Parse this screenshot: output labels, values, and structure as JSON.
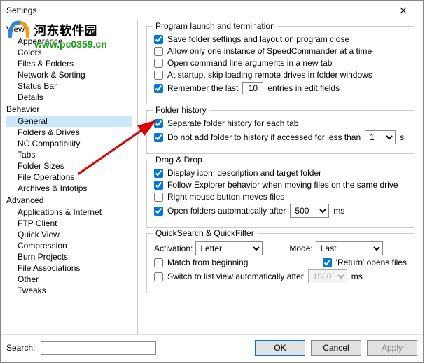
{
  "window": {
    "title": "Settings"
  },
  "watermark": {
    "site_cn": "河东软件园",
    "url": "www.pc0359.cn",
    "view": "View"
  },
  "tree": {
    "cat_view": "View",
    "cat_behavior": "Behavior",
    "cat_advanced": "Advanced",
    "view_items": [
      "Appearance",
      "Colors",
      "Files & Folders",
      "Network & Sorting",
      "Status Bar",
      "Details"
    ],
    "behavior_items": [
      "General",
      "Folders & Drives",
      "NC Compatibility",
      "Tabs",
      "Folder Sizes",
      "File Operations",
      "Archives & Infotips"
    ],
    "advanced_items": [
      "Applications & Internet",
      "FTP Client",
      "Quick View",
      "Compression",
      "Burn Projects",
      "File Associations",
      "Other",
      "Tweaks"
    ],
    "selected": "General"
  },
  "groups": {
    "launch": {
      "legend": "Program launch and termination",
      "save_folder": "Save folder settings and layout on program close",
      "only_one": "Allow only one instance of SpeedCommander at a time",
      "cmd_args": "Open command line arguments in a new tab",
      "skip_remote": "At startup, skip loading remote drives in folder windows",
      "remember_a": "Remember the last",
      "remember_b": "entries in edit fields",
      "remember_val": "10"
    },
    "history": {
      "legend": "Folder history",
      "separate": "Separate folder history for each tab",
      "noadd_a": "Do not add folder to history if accessed for less than",
      "noadd_b": "s",
      "noadd_val": "1"
    },
    "dragdrop": {
      "legend": "Drag & Drop",
      "display_icon": "Display icon, description and target folder",
      "follow_explorer": "Follow Explorer behavior when moving files on the same drive",
      "right_mouse": "Right mouse button moves files",
      "open_auto_a": "Open folders automatically after",
      "open_auto_b": "ms",
      "open_auto_val": "500"
    },
    "quicksearch": {
      "legend": "QuickSearch & QuickFilter",
      "activation_lbl": "Activation:",
      "activation_val": "Letter",
      "mode_lbl": "Mode:",
      "mode_val": "Last",
      "match_begin": "Match from beginning",
      "return_opens": "'Return' opens files",
      "switch_list_a": "Switch to list view automatically after",
      "switch_list_b": "ms",
      "switch_list_val": "1500"
    }
  },
  "footer": {
    "search": "Search:",
    "ok": "OK",
    "cancel": "Cancel",
    "apply": "Apply"
  }
}
